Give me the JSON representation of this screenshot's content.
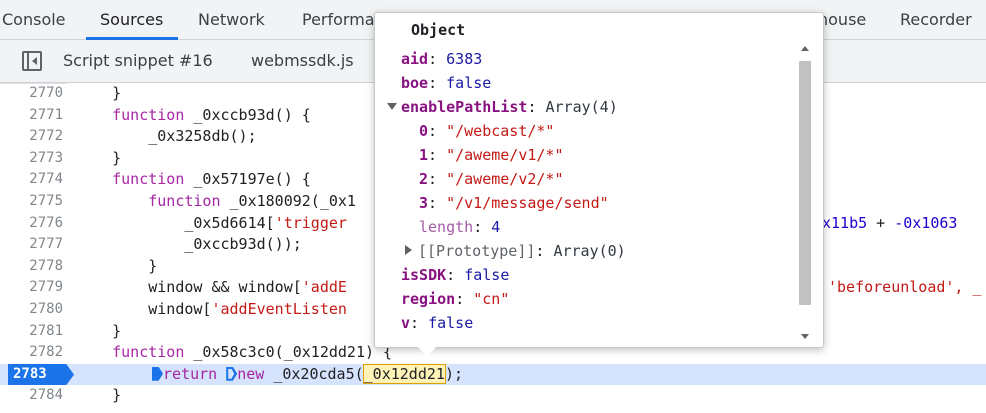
{
  "tabs": [
    {
      "label": "Console"
    },
    {
      "label": "Sources",
      "active": true
    },
    {
      "label": "Network"
    },
    {
      "label": "Performa"
    },
    {
      "label": "nouse"
    },
    {
      "label": "Recorder"
    }
  ],
  "file_tabs": [
    {
      "label": "Script snippet #16"
    },
    {
      "label": "webmssdk.js"
    }
  ],
  "code": {
    "current_line": 2783,
    "lines": [
      {
        "num": "2770",
        "text": "    }"
      },
      {
        "num": "2771",
        "text": "    function _0xccb93d() {"
      },
      {
        "num": "2772",
        "text": "        _0x3258db();"
      },
      {
        "num": "2773",
        "text": "    }"
      },
      {
        "num": "2774",
        "text": "    function _0x57197e() {"
      },
      {
        "num": "2775",
        "text": "        function _0x180092(_0x1"
      },
      {
        "num": "2776",
        "text": "            _0x5d6614['trigger"
      },
      {
        "num": "2777",
        "text": "            _0xccb93d());"
      },
      {
        "num": "2778",
        "text": "        }"
      },
      {
        "num": "2779",
        "text": "        window && window['addE"
      },
      {
        "num": "2780",
        "text": "        window['addEventListen"
      },
      {
        "num": "2781",
        "text": "    }"
      },
      {
        "num": "2782",
        "text": "    function _0x58c3c0(_0x12dd21) {"
      },
      {
        "num": "2783",
        "text": "return new _0x20cda5(_0x12dd21);"
      },
      {
        "num": "2784",
        "text": "    }"
      }
    ],
    "right_fragments": {
      "line_2776": "x11b5 + -0x1063",
      "line_2779": "'beforeunload', _"
    },
    "exec_line_parts": {
      "kw_return": "return",
      "kw_new": "new",
      "call": "_0x20cda5(",
      "arg": "_0x12dd21",
      "tail": ");"
    }
  },
  "popover": {
    "title": "Object",
    "aid": {
      "key": "aid",
      "value": "6383"
    },
    "boe": {
      "key": "boe",
      "value": "false"
    },
    "enablePathList": {
      "key": "enablePathList",
      "value": "Array(4)"
    },
    "items": [
      {
        "key": "0",
        "value": "\"/webcast/*\""
      },
      {
        "key": "1",
        "value": "\"/aweme/v1/*\""
      },
      {
        "key": "2",
        "value": "\"/aweme/v2/*\""
      },
      {
        "key": "3",
        "value": "\"/v1/message/send\""
      }
    ],
    "length": {
      "key": "length",
      "value": "4"
    },
    "prototype": {
      "key": "[[Prototype]]",
      "value": "Array(0)"
    },
    "isSDK": {
      "key": "isSDK",
      "value": "false"
    },
    "region": {
      "key": "region",
      "value": "\"cn\""
    },
    "v": {
      "key": "v",
      "value": "false"
    }
  }
}
